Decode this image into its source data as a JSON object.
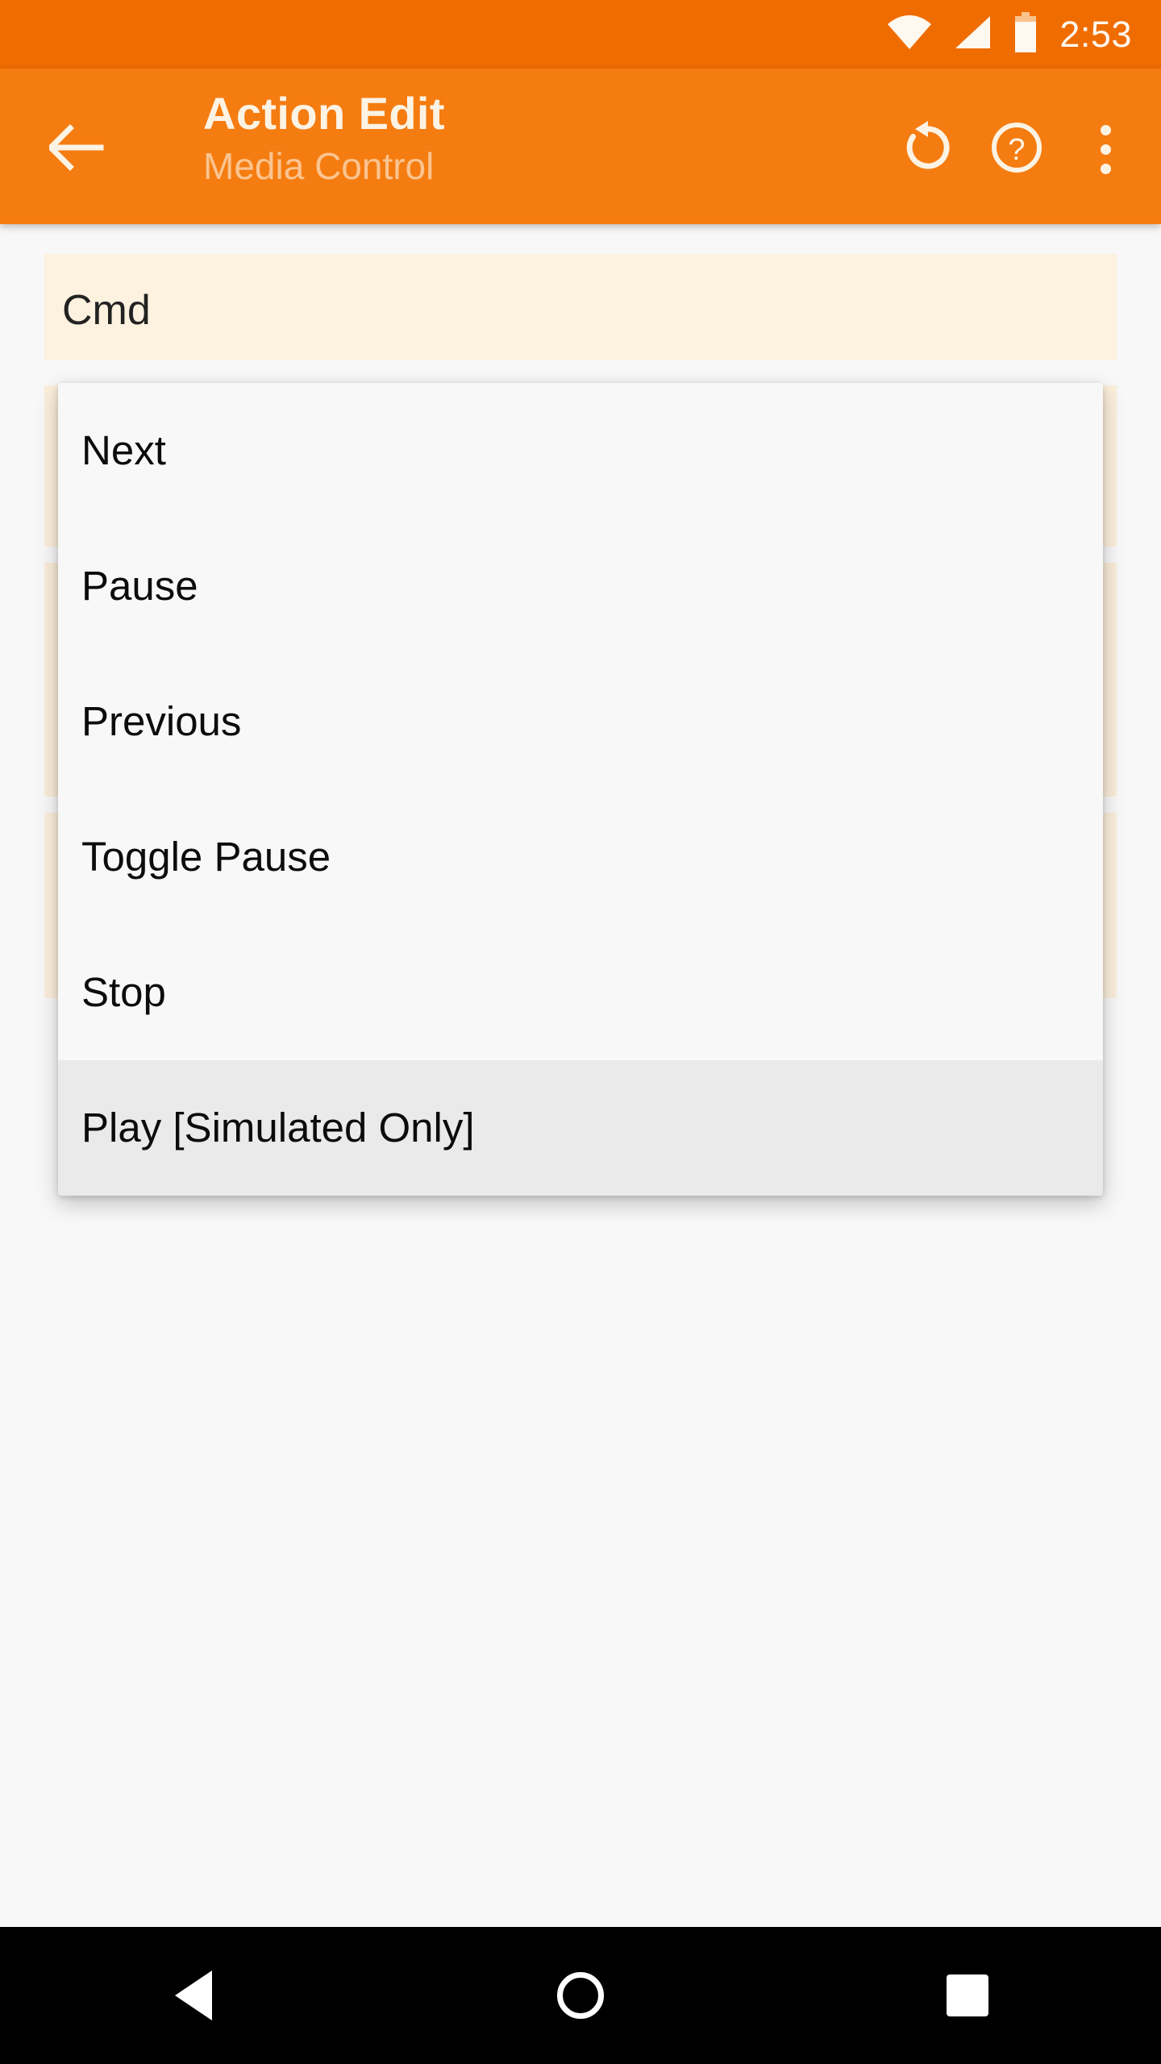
{
  "status_bar": {
    "time": "2:53",
    "icons": [
      "wifi-icon",
      "cellular-signal-icon",
      "battery-icon"
    ],
    "background_color": "#EF6C00"
  },
  "app_bar": {
    "background_color": "#F57C10",
    "back_label": "back-arrow-icon",
    "title": "Action Edit",
    "subtitle": "Media Control",
    "actions": [
      {
        "name": "restore-icon",
        "label": "Restore"
      },
      {
        "name": "help-icon",
        "label": "Help"
      },
      {
        "name": "overflow-menu-icon",
        "label": "More options"
      }
    ]
  },
  "form": {
    "card_color": "#FDF1DF",
    "fields": [
      {
        "label": "Cmd"
      }
    ]
  },
  "dropdown": {
    "background_color": "#F8F8F8",
    "selected_color": "#EAEAEA",
    "selected_index": 5,
    "options": [
      {
        "label": "Next"
      },
      {
        "label": "Pause"
      },
      {
        "label": "Previous"
      },
      {
        "label": "Toggle Pause"
      },
      {
        "label": "Stop"
      },
      {
        "label": "Play [Simulated Only]"
      }
    ]
  },
  "nav_bar": {
    "background_color": "#000000",
    "buttons": [
      {
        "name": "nav-back-icon",
        "label": "Back"
      },
      {
        "name": "nav-home-icon",
        "label": "Home"
      },
      {
        "name": "nav-recents-icon",
        "label": "Recents"
      }
    ]
  }
}
